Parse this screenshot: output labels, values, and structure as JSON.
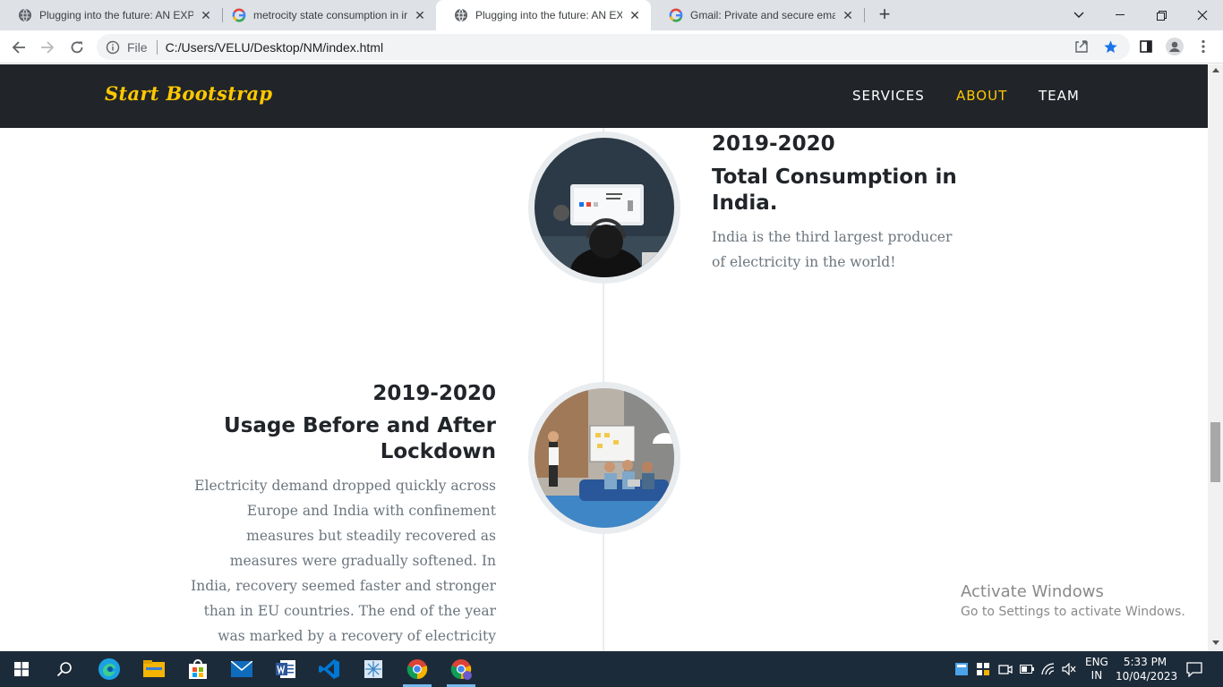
{
  "browser": {
    "tabs": [
      {
        "title": "Plugging into the future: AN EXP",
        "icon": "globe-icon",
        "active": false
      },
      {
        "title": "metrocity state consumption in ir",
        "icon": "google-icon",
        "active": false
      },
      {
        "title": "Plugging into the future: AN EXP",
        "icon": "globe-icon",
        "active": true
      },
      {
        "title": "Gmail: Private and secure email a",
        "icon": "google-icon",
        "active": false
      }
    ],
    "address": {
      "scheme": "File",
      "url": "C:/Users/VELU/Desktop/NM/index.html"
    }
  },
  "site": {
    "brand": "Start Bootstrap",
    "nav": [
      "Services",
      "About",
      "Team"
    ],
    "active_nav": "About",
    "colors": {
      "accent": "#ffc800",
      "navbar": "#212529",
      "text": "#212529",
      "muted": "#6c757d"
    }
  },
  "timeline": [
    {
      "date": "2019-2020",
      "title": "Total Consumption in India.",
      "body": "India is the third largest producer of electricity in the world!",
      "image": "person-at-monitor-photo"
    },
    {
      "date": "2019-2020",
      "title": "Usage Before and After Lockdown",
      "body": "Electricity demand dropped quickly across Europe and India with confinement measures but steadily recovered as measures were gradually softened. In India, recovery seemed faster and stronger than in EU countries. The end of the year was marked by a recovery of electricity demand,",
      "image": "team-meeting-photo"
    }
  ],
  "watermark": {
    "line1": "Activate Windows",
    "line2": "Go to Settings to activate Windows."
  },
  "taskbar": {
    "lang": {
      "line1": "ENG",
      "line2": "IN"
    },
    "time": "5:33 PM",
    "date": "10/04/2023"
  }
}
